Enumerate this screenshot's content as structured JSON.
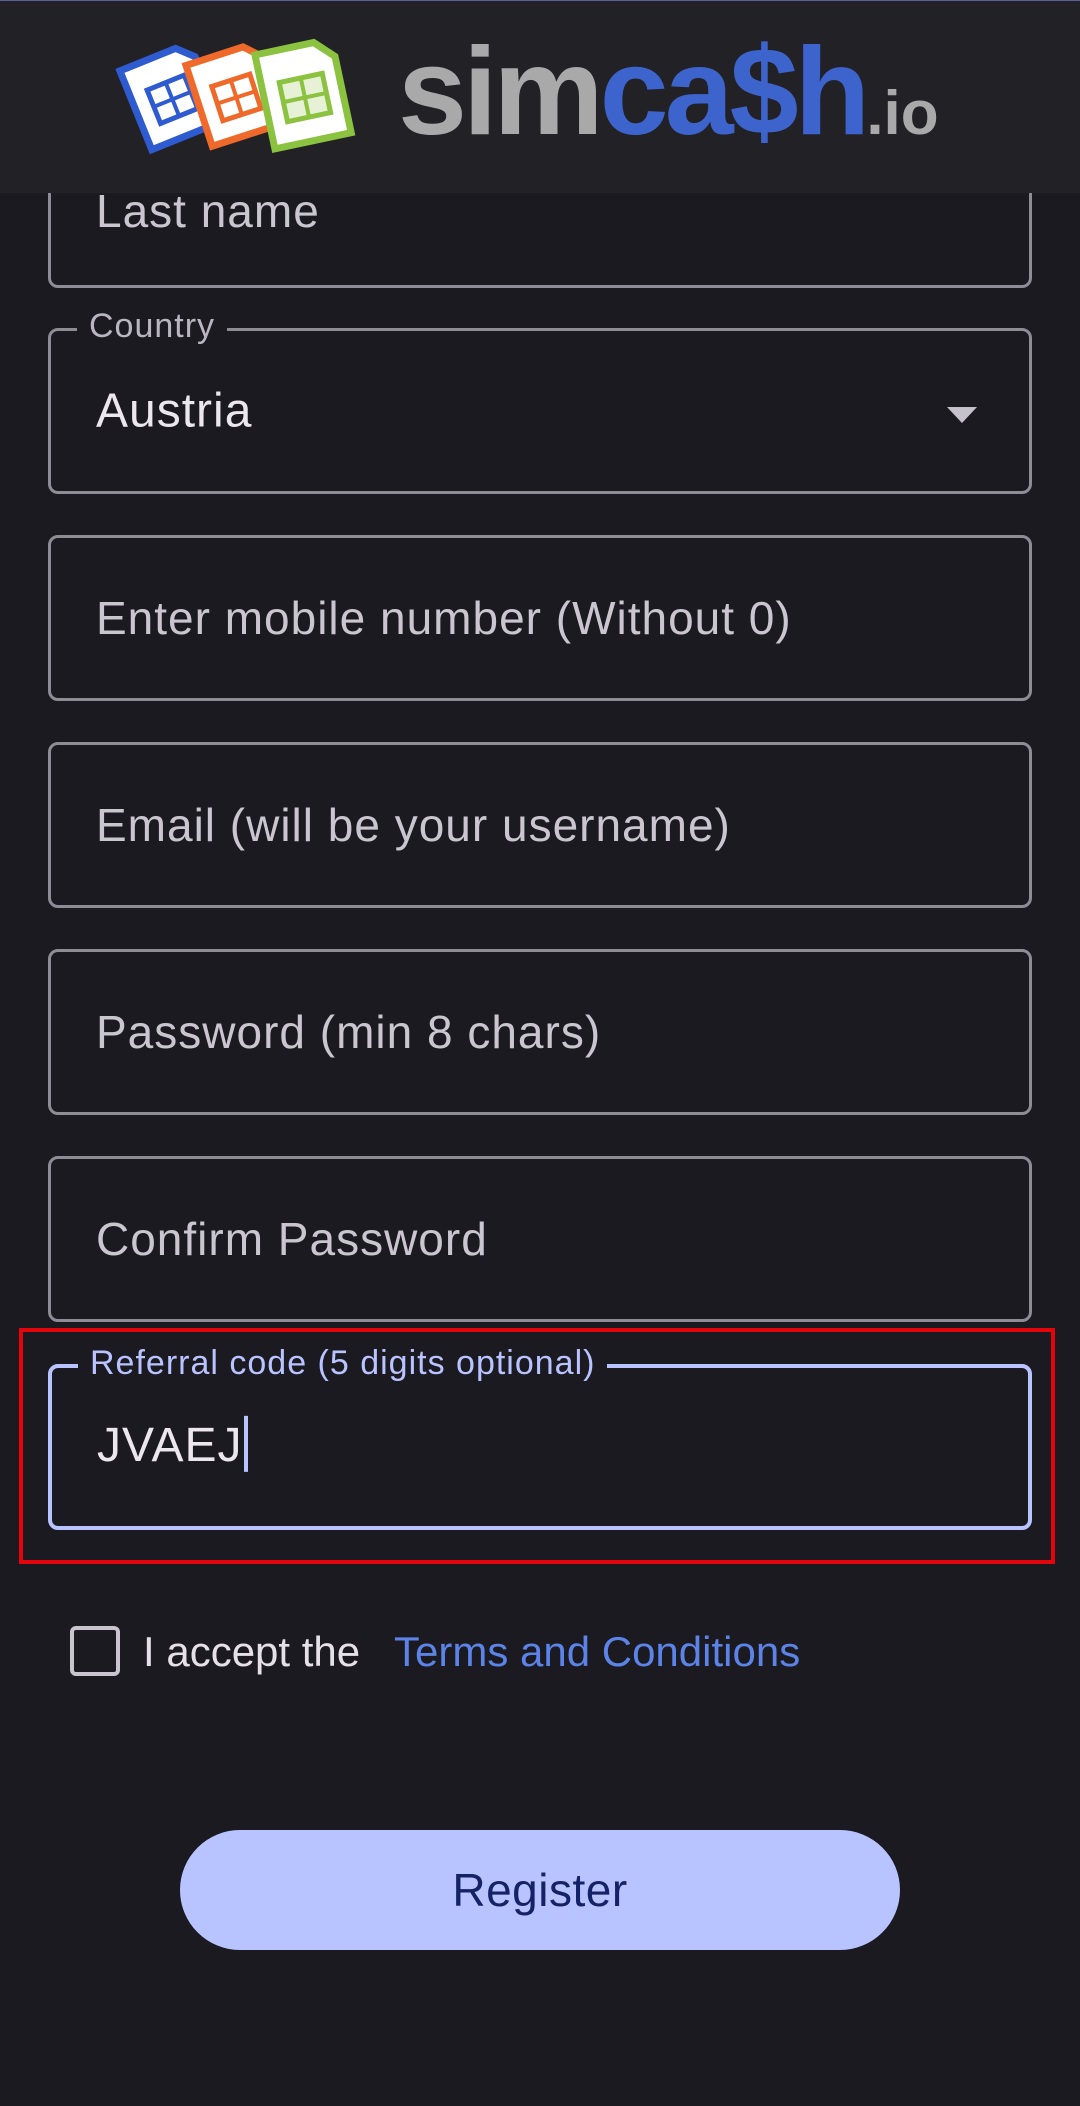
{
  "brand": {
    "name_part1": "sim",
    "name_part2": "ca$h",
    "name_part3": ".io"
  },
  "form": {
    "last_name": {
      "placeholder": "Last name"
    },
    "country": {
      "label": "Country",
      "value": "Austria"
    },
    "mobile": {
      "placeholder": "Enter mobile number (Without 0)"
    },
    "email": {
      "placeholder": "Email (will be your username)"
    },
    "password": {
      "placeholder": "Password (min 8 chars)"
    },
    "confirm_password": {
      "placeholder": "Confirm Password"
    },
    "referral": {
      "label": "Referral code (5 digits optional)",
      "value": "JVAEJ"
    },
    "terms": {
      "prefix": "I accept the",
      "link": "Terms and Conditions",
      "checked": false
    },
    "register_label": "Register"
  },
  "colors": {
    "background": "#1b1a21",
    "accent": "#b8c4ff",
    "link": "#5b83e8",
    "highlight": "#e3040c"
  }
}
